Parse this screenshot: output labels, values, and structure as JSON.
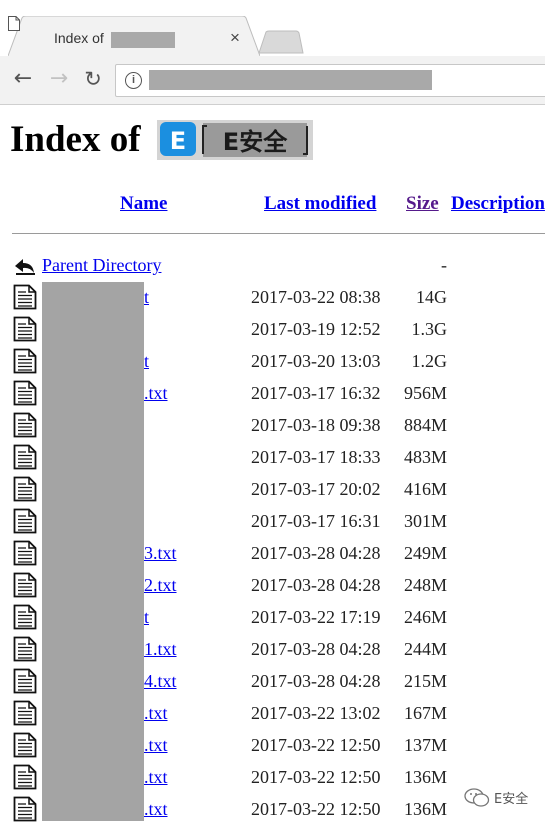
{
  "browser": {
    "tab_title": "Index of",
    "tab_close_glyph": "×",
    "back_glyph": "←",
    "forward_glyph": "→",
    "reload_glyph": "↻",
    "info_glyph": "i"
  },
  "page": {
    "heading": "Index of",
    "logo_text": "E安全",
    "logo_badge": "E",
    "columns": {
      "name": "Name",
      "last_modified": "Last modified",
      "size": "Size",
      "description": "Description"
    },
    "parent": {
      "name": "Parent Directory",
      "size": "-"
    },
    "files": [
      {
        "name_suffix": "t",
        "modified": "2017-03-22 08:38",
        "size": "14G"
      },
      {
        "name_suffix": "",
        "modified": "2017-03-19 12:52",
        "size": "1.3G"
      },
      {
        "name_suffix": "t",
        "modified": "2017-03-20 13:03",
        "size": "1.2G"
      },
      {
        "name_suffix": ".txt",
        "modified": "2017-03-17 16:32",
        "size": "956M"
      },
      {
        "name_suffix": "",
        "modified": "2017-03-18 09:38",
        "size": "884M"
      },
      {
        "name_suffix": "",
        "modified": "2017-03-17 18:33",
        "size": "483M"
      },
      {
        "name_suffix": "",
        "modified": "2017-03-17 20:02",
        "size": "416M"
      },
      {
        "name_suffix": "",
        "modified": "2017-03-17 16:31",
        "size": "301M"
      },
      {
        "name_suffix": "3.txt",
        "modified": "2017-03-28 04:28",
        "size": "249M"
      },
      {
        "name_suffix": "2.txt",
        "modified": "2017-03-28 04:28",
        "size": "248M"
      },
      {
        "name_suffix": "t",
        "modified": "2017-03-22 17:19",
        "size": "246M"
      },
      {
        "name_suffix": "1.txt",
        "modified": "2017-03-28 04:28",
        "size": "244M"
      },
      {
        "name_suffix": "4.txt",
        "modified": "2017-03-28 04:28",
        "size": "215M"
      },
      {
        "name_suffix": ".txt",
        "modified": "2017-03-22 13:02",
        "size": "167M"
      },
      {
        "name_suffix": ".txt",
        "modified": "2017-03-22 12:50",
        "size": "137M"
      },
      {
        "name_suffix": ".txt",
        "modified": "2017-03-22 12:50",
        "size": "136M"
      },
      {
        "name_suffix": ".txt",
        "modified": "2017-03-22 12:50",
        "size": "136M"
      }
    ]
  },
  "watermark": {
    "text": "E安全"
  },
  "colors": {
    "link": "#0000ee",
    "visited": "#551a8b",
    "redaction": "#a4a4a4"
  }
}
